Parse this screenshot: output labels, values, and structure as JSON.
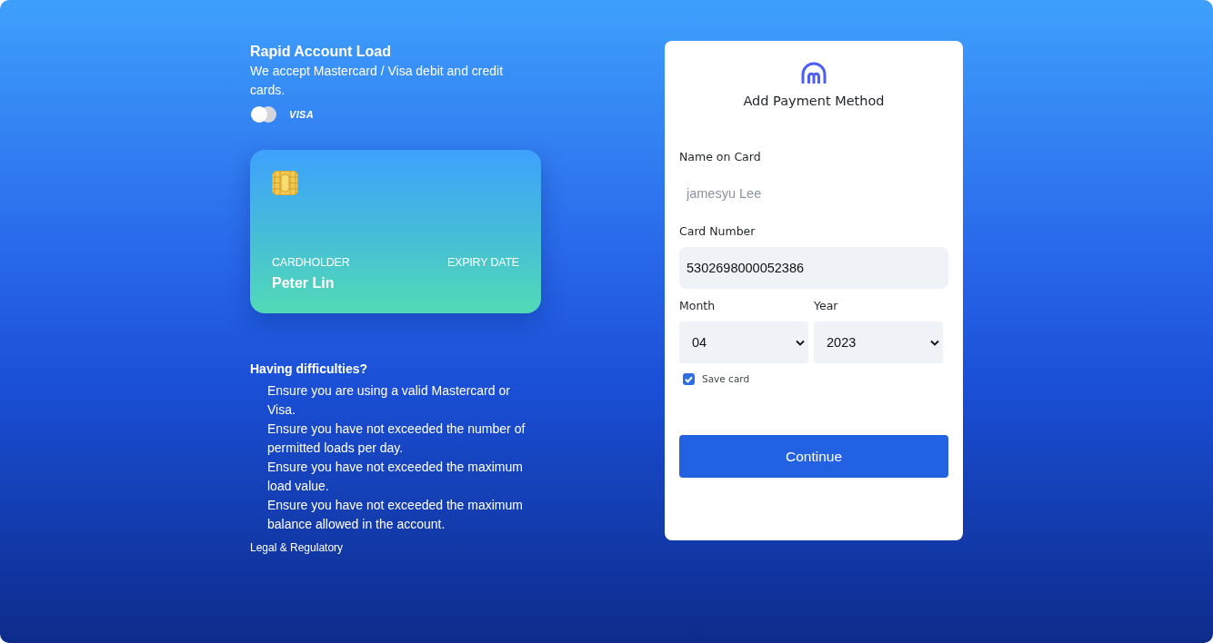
{
  "intro": {
    "title": "Rapid Account Load",
    "description": "We accept Mastercard / Visa debit and credit cards.",
    "brands": [
      {
        "kind": "mastercard"
      },
      {
        "kind": "visa",
        "label": "VISA"
      }
    ]
  },
  "card_preview": {
    "holder_label": "CARDHOLDER",
    "holder_name": "Peter Lin",
    "expiry_label": "EXPIRY DATE"
  },
  "help": {
    "title": "Having difficulties?",
    "items": [
      "Ensure you are using a valid Mastercard or Visa.",
      "Ensure you have not exceeded the number of permitted loads per day.",
      "Ensure you have not exceeded the maximum load value.",
      "Ensure you have not exceeded the maximum balance allowed in the account."
    ]
  },
  "footer_link": "Legal & Regulatory",
  "form": {
    "title": "Add Payment Method",
    "fields": [
      {
        "label": "Name on Card",
        "placeholder": "jamesyu Lee"
      },
      {
        "label": "Card Number",
        "value": "5302698000052386"
      }
    ],
    "selects": [
      {
        "label": "Month",
        "value": "04"
      },
      {
        "label": "Year",
        "value": "2023"
      }
    ],
    "save_card": {
      "label": "Save card",
      "checked": true
    },
    "submit": "Continue"
  }
}
